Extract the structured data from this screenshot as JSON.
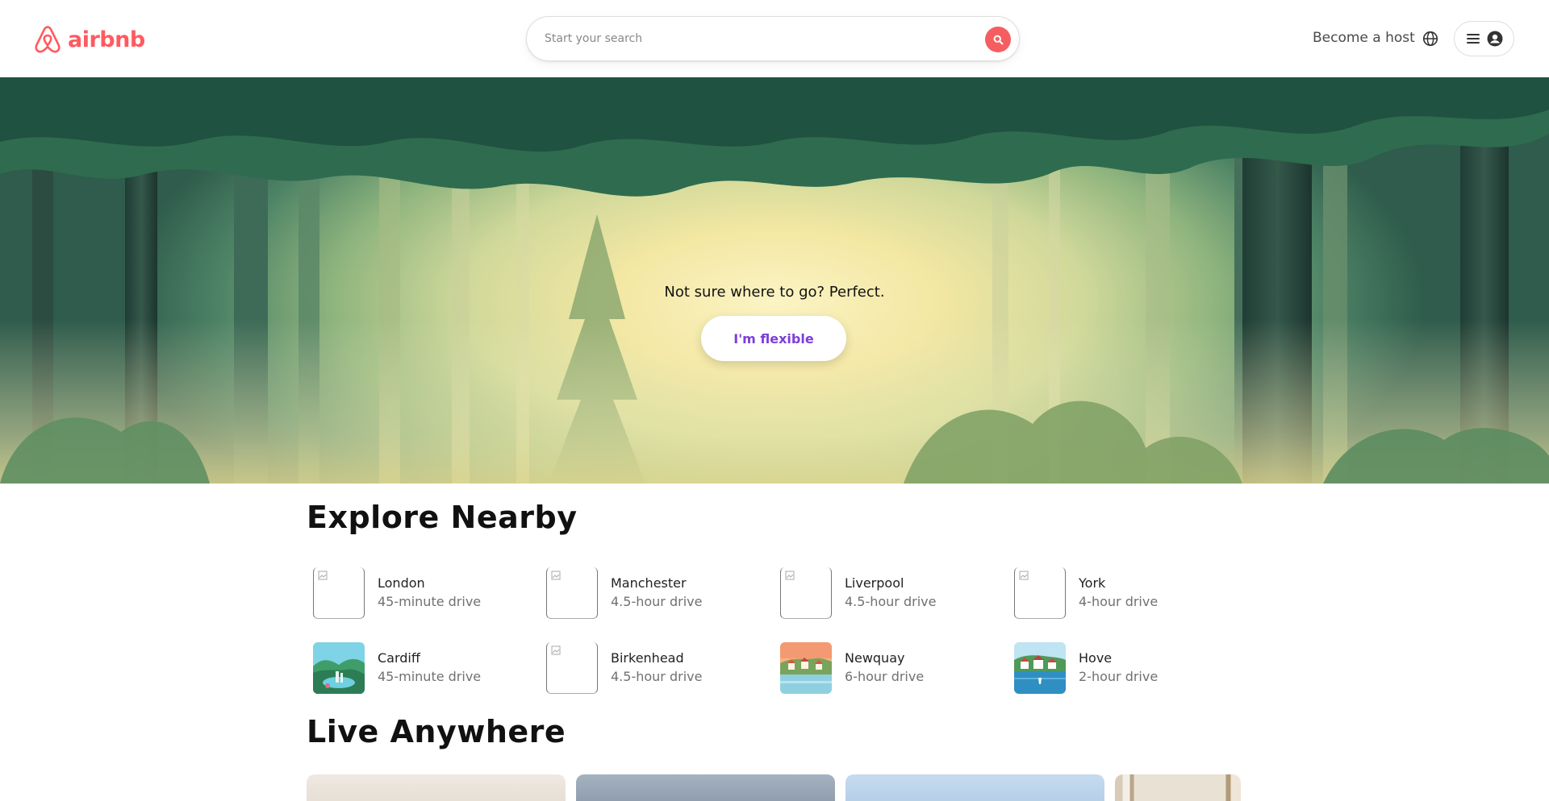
{
  "header": {
    "logo_text": "airbnb",
    "search_placeholder": "Start your search",
    "become_host": "Become a host",
    "icons": [
      "airbnb-logo-icon",
      "search-icon",
      "globe-icon",
      "hamburger-menu-icon",
      "user-avatar-icon"
    ]
  },
  "hero": {
    "tagline": "Not sure where to go? Perfect.",
    "button_label": "I'm flexible"
  },
  "explore_nearby": {
    "title": "Explore Nearby",
    "items": [
      {
        "city": "London",
        "drive": "45-minute drive",
        "image": "broken"
      },
      {
        "city": "Manchester",
        "drive": "4.5-hour drive",
        "image": "broken"
      },
      {
        "city": "Liverpool",
        "drive": "4.5-hour drive",
        "image": "broken"
      },
      {
        "city": "York",
        "drive": "4-hour drive",
        "image": "broken"
      },
      {
        "city": "Cardiff",
        "drive": "45-minute drive",
        "image": "lake-illustration"
      },
      {
        "city": "Birkenhead",
        "drive": "4.5-hour drive",
        "image": "broken"
      },
      {
        "city": "Newquay",
        "drive": "6-hour drive",
        "image": "village-sunset-illustration"
      },
      {
        "city": "Hove",
        "drive": "2-hour drive",
        "image": "harbor-illustration"
      }
    ]
  },
  "live_anywhere": {
    "title": "Live Anywhere"
  },
  "colors": {
    "brand": "#ff5a5f",
    "flexible_text": "#7d3ed8",
    "muted_text": "#717171"
  }
}
